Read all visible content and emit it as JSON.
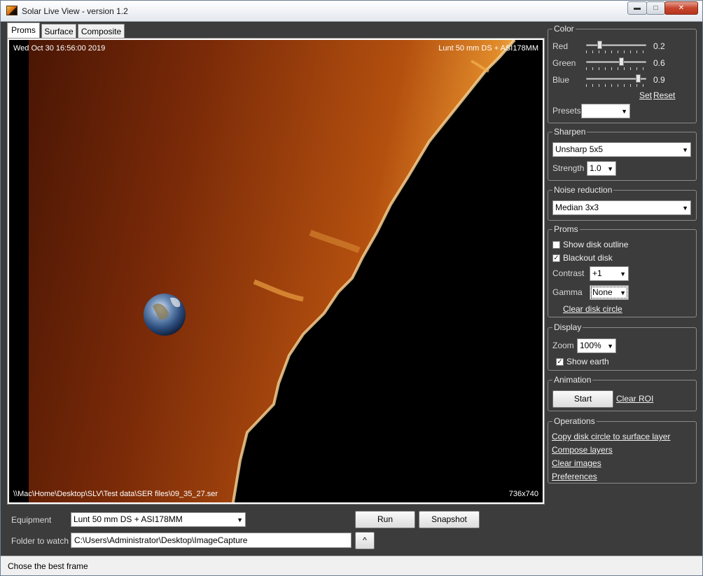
{
  "window": {
    "title": "Solar Live View - version 1.2",
    "min_glyph": "▬",
    "max_glyph": "□",
    "close_glyph": "✕"
  },
  "tabs": [
    {
      "label": "Proms",
      "active": true
    },
    {
      "label": "Surface",
      "active": false
    },
    {
      "label": "Composite",
      "active": false
    }
  ],
  "view": {
    "timestamp": "Wed Oct 30 16:56:00 2019",
    "equipment_overlay": "Lunt 50 mm DS + ASI178MM",
    "file_path": "\\\\Mac\\Home\\Desktop\\SLV\\Test data\\SER files\\09_35_27.ser",
    "dimensions": "736x740"
  },
  "color": {
    "title": "Color",
    "sliders": [
      {
        "label": "Red",
        "value": "0.2",
        "level": 0.2
      },
      {
        "label": "Green",
        "value": "0.6",
        "level": 0.6
      },
      {
        "label": "Blue",
        "value": "0.9",
        "level": 0.9
      }
    ],
    "set_label": "Set",
    "reset_label": "Reset",
    "presets_label": "Presets",
    "presets_value": ""
  },
  "sharpen": {
    "title": "Sharpen",
    "method": "Unsharp 5x5",
    "strength_label": "Strength",
    "strength_value": "1.0"
  },
  "noise": {
    "title": "Noise reduction",
    "method": "Median 3x3"
  },
  "proms": {
    "title": "Proms",
    "show_disk_outline_label": "Show disk outline",
    "show_disk_outline": false,
    "blackout_disk_label": "Blackout disk",
    "blackout_disk": true,
    "contrast_label": "Contrast",
    "contrast_value": "+1",
    "gamma_label": "Gamma",
    "gamma_value": "None",
    "clear_disk_circle": "Clear disk circle"
  },
  "display": {
    "title": "Display",
    "zoom_label": "Zoom",
    "zoom_value": "100%",
    "show_earth_label": "Show earth",
    "show_earth": true
  },
  "animation": {
    "title": "Animation",
    "start_label": "Start",
    "clear_roi": "Clear ROI"
  },
  "operations": {
    "title": "Operations",
    "links": [
      "Copy disk circle to surface layer",
      "Compose layers",
      "Clear images",
      "Preferences"
    ]
  },
  "bottom": {
    "equipment_label": "Equipment",
    "equipment_value": "Lunt 50 mm DS + ASI178MM",
    "run_label": "Run",
    "snapshot_label": "Snapshot",
    "folder_label": "Folder to watch",
    "folder_value": "C:\\Users\\Administrator\\Desktop\\ImageCapture",
    "browse_label": "^"
  },
  "status": {
    "text": "Chose the best frame"
  },
  "icons": {
    "arrow": "▼",
    "check": "✓"
  }
}
